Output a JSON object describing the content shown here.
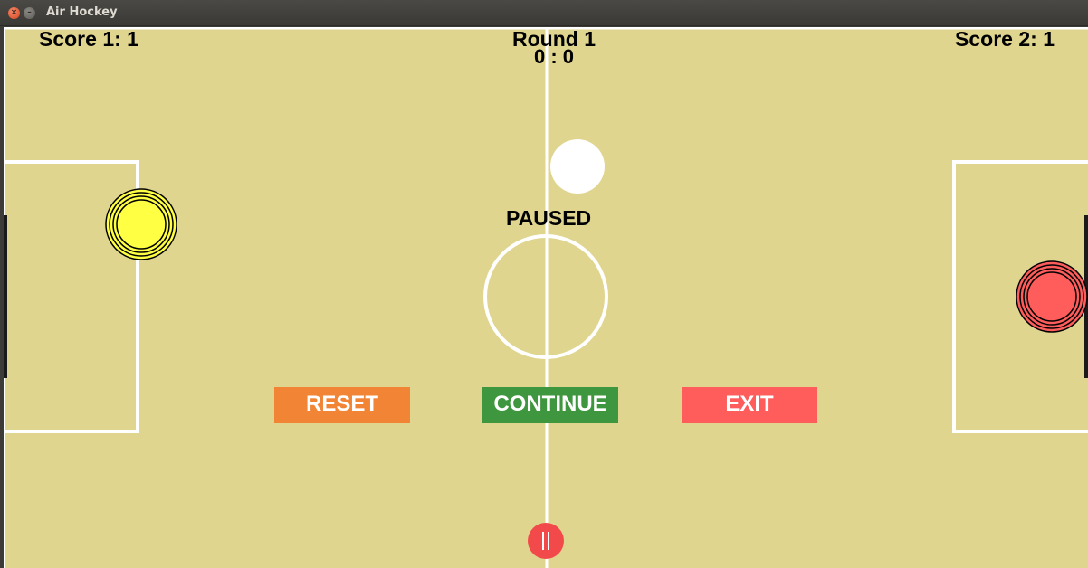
{
  "window": {
    "title": "Air Hockey",
    "close_glyph": "×",
    "minimize_glyph": "–"
  },
  "hud": {
    "score1": "Score 1: 1",
    "score2": "Score 2: 1",
    "round": "Round 1",
    "round_score": "0 : 0",
    "status": "PAUSED"
  },
  "menu": {
    "reset_label": "RESET",
    "continue_label": "CONTINUE",
    "exit_label": "EXIT"
  },
  "colors": {
    "field": "#e0d58f",
    "lines": "#ffffff",
    "puck": "#ffffff",
    "player1_mallet": "#ffff44",
    "player2_mallet": "#ff5c5c",
    "reset": "#f28535",
    "continue": "#3e963e",
    "exit": "#ff5c5c",
    "pause": "#f24a4a"
  },
  "icons": {
    "pause": "pause-icon"
  }
}
